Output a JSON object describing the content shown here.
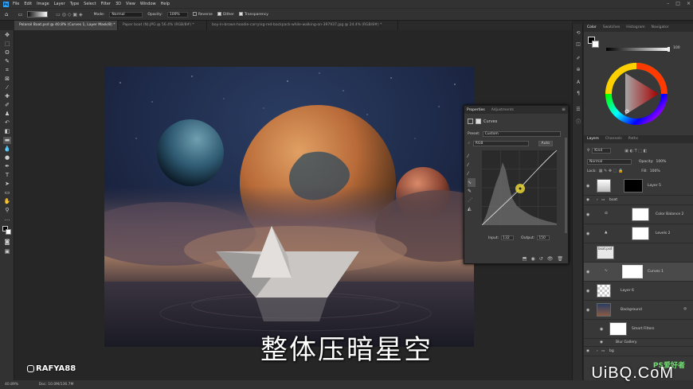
{
  "menu": [
    "File",
    "Edit",
    "Image",
    "Layer",
    "Type",
    "Select",
    "Filter",
    "3D",
    "View",
    "Window",
    "Help"
  ],
  "options": {
    "mode_label": "Mode:",
    "mode_value": "Normal",
    "opacity_label": "Opacity:",
    "opacity_value": "100%",
    "reverse": "Reverse",
    "dither": "Dither",
    "transparency": "Transparency"
  },
  "tabs": [
    {
      "label": "Polaroil Boat.psd @ 40.8% (Curves 1, Layer Mask/8) *",
      "active": true
    },
    {
      "label": "Paper boat (N).JPG @ 56.4% (RGB/8#) *",
      "active": false
    },
    {
      "label": "boy-in-brown-hoodie-carrying-red-backpack-while-walking-on-397937.jpg @ 24.4% (RGB/8#) *",
      "active": false
    }
  ],
  "properties": {
    "tab_active": "Properties",
    "tab_inactive": "Adjustments",
    "panel_title": "Curves",
    "preset_label": "Preset:",
    "preset_value": "Custom",
    "channel_value": "RGB",
    "auto_label": "Auto",
    "input_label": "Input:",
    "input_value": "132",
    "output_label": "Output:",
    "output_value": "150"
  },
  "color_panel": {
    "tabs": [
      "Color",
      "Swatches",
      "Histogram",
      "Navigator"
    ],
    "slider_value": "100",
    "slider_pct": 100
  },
  "layers_panel": {
    "tabs": [
      "Layers",
      "Channels",
      "Paths"
    ],
    "kind_label": "Kind",
    "blend_value": "Normal",
    "opacity_label": "Opacity:",
    "opacity_value": "100%",
    "lock_label": "Lock:",
    "fill_label": "Fill:",
    "fill_value": "100%",
    "layers": [
      {
        "name": "Layer 5",
        "type": "mask"
      },
      {
        "name": "boat",
        "type": "group"
      },
      {
        "name": "Color Balance 2",
        "type": "adjust"
      },
      {
        "name": "Levels 2",
        "type": "adjust"
      },
      {
        "name": "boat.psd",
        "type": "smart"
      },
      {
        "name": "Curves 1",
        "type": "adjust",
        "selected": true
      },
      {
        "name": "Layer 6",
        "type": "pixel"
      },
      {
        "name": "Background",
        "type": "smart"
      },
      {
        "name": "Smart Filters",
        "type": "filter"
      },
      {
        "name": "Blur Gallery",
        "type": "filteritem"
      },
      {
        "name": "bg",
        "type": "group"
      }
    ]
  },
  "status": {
    "zoom": "40.89%",
    "doc": "Doc: 10.0M/136.7M"
  },
  "overlay": {
    "subtitle": "整体压暗星空",
    "watermark": "RAFYA88",
    "brand": "UiBQ.CoM",
    "brand_small": "PS爱好者"
  }
}
